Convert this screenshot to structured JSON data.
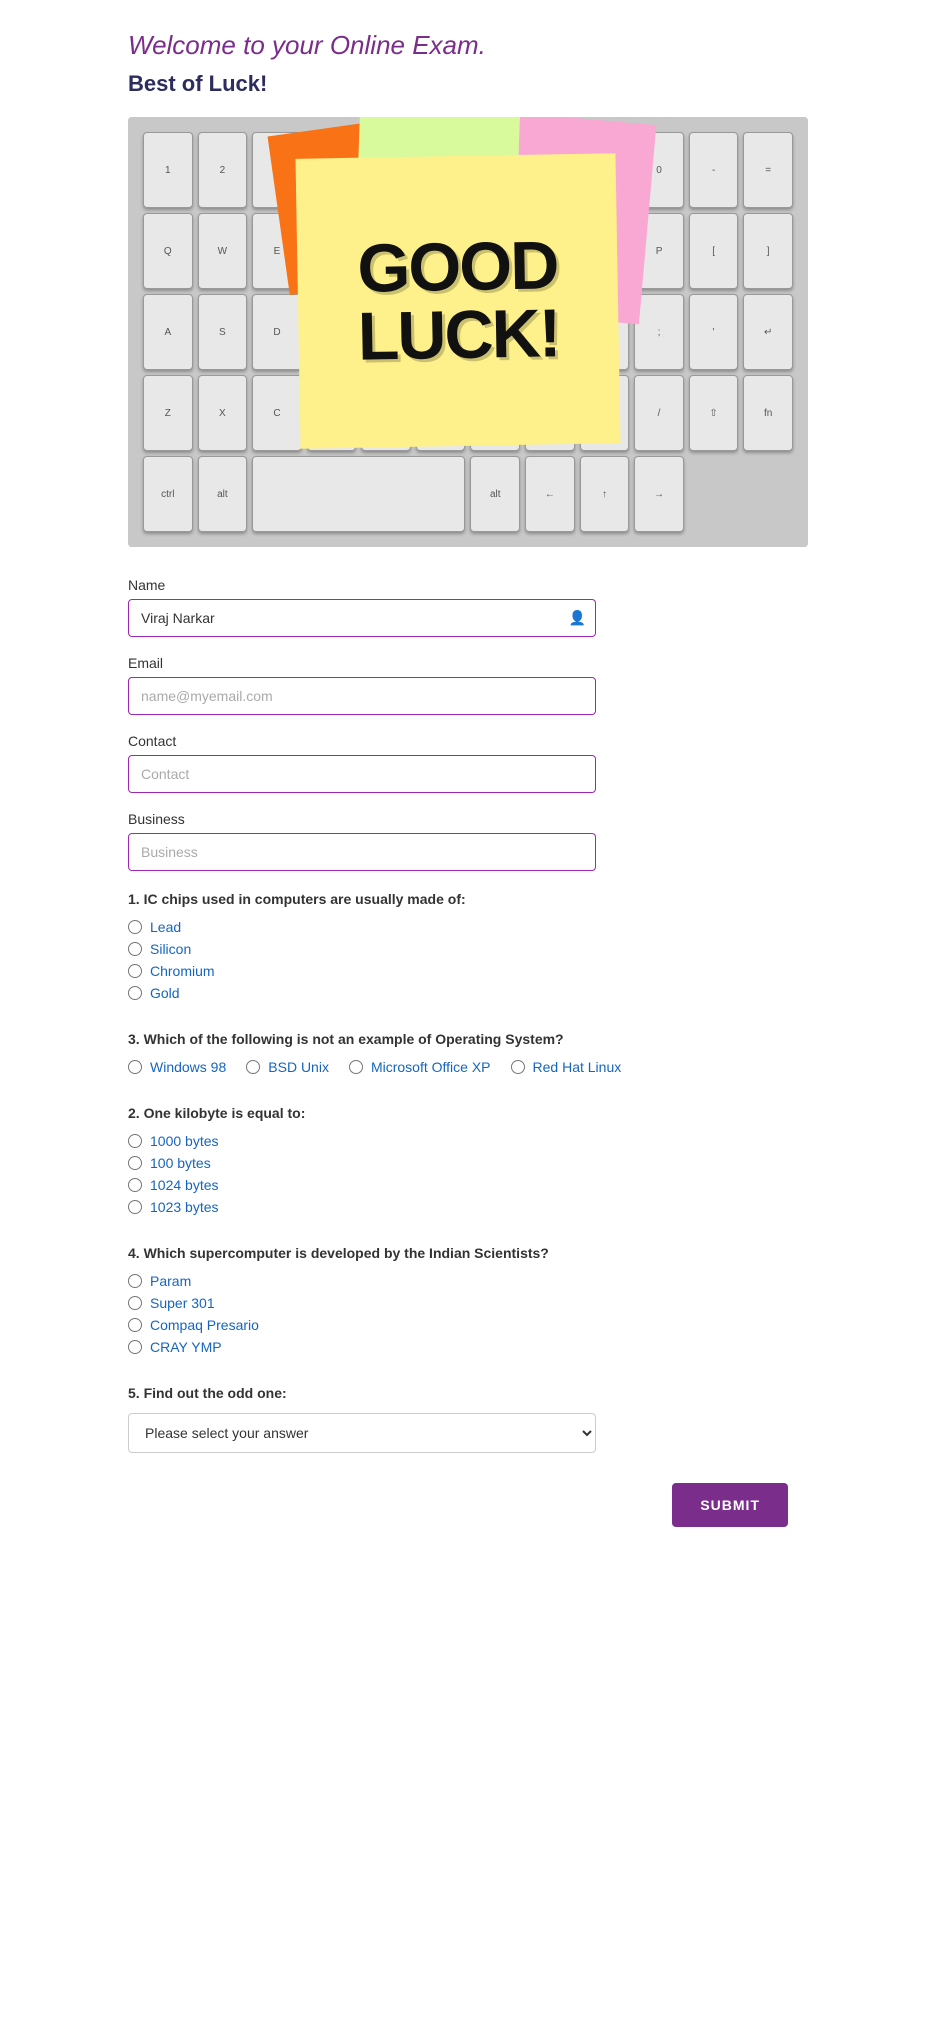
{
  "header": {
    "welcome_text": "Welcome to your ",
    "welcome_highlight": "Online Exam.",
    "best_luck": "Best of Luck!"
  },
  "hero_image": {
    "alt": "Good Luck sticky note on keyboard"
  },
  "form": {
    "name_label": "Name",
    "name_value": "Viraj Narkar",
    "name_placeholder": "Viraj Narkar",
    "email_label": "Email",
    "email_placeholder": "name@myemail.com",
    "contact_label": "Contact",
    "contact_placeholder": "Contact",
    "business_label": "Business",
    "business_placeholder": "Business"
  },
  "questions": [
    {
      "id": "q1",
      "number": "1.",
      "text": "IC chips used in computers are usually made of:",
      "type": "radio-vertical",
      "options": [
        {
          "value": "lead",
          "label": "Lead"
        },
        {
          "value": "silicon",
          "label": "Silicon"
        },
        {
          "value": "chromium",
          "label": "Chromium"
        },
        {
          "value": "gold",
          "label": "Gold"
        }
      ]
    },
    {
      "id": "q3",
      "number": "3.",
      "text": "Which of the following is not an example of Operating System?",
      "type": "radio-horizontal",
      "options": [
        {
          "value": "windows98",
          "label": "Windows 98"
        },
        {
          "value": "bsdunix",
          "label": "BSD Unix"
        },
        {
          "value": "msoffice",
          "label": "Microsoft Office XP"
        },
        {
          "value": "redhat",
          "label": "Red Hat Linux"
        }
      ]
    },
    {
      "id": "q2",
      "number": "2.",
      "text": "One kilobyte is equal to:",
      "type": "radio-vertical",
      "options": [
        {
          "value": "1000bytes",
          "label": "1000 bytes"
        },
        {
          "value": "100bytes",
          "label": "100 bytes"
        },
        {
          "value": "1024bytes",
          "label": "1024 bytes"
        },
        {
          "value": "1023bytes",
          "label": "1023 bytes"
        }
      ]
    },
    {
      "id": "q4",
      "number": "4.",
      "text": "Which supercomputer is developed by the Indian Scientists?",
      "type": "radio-vertical",
      "options": [
        {
          "value": "param",
          "label": "Param"
        },
        {
          "value": "super301",
          "label": "Super 301"
        },
        {
          "value": "compaqpresario",
          "label": "Compaq Presario"
        },
        {
          "value": "crayymp",
          "label": "CRAY YMP"
        }
      ]
    },
    {
      "id": "q5",
      "number": "5.",
      "text": "Find out the odd one:",
      "type": "dropdown",
      "placeholder": "Please select your answer",
      "options": [
        {
          "value": "",
          "label": "Please select your answer"
        }
      ]
    }
  ],
  "submit": {
    "label": "SUBMIT"
  }
}
